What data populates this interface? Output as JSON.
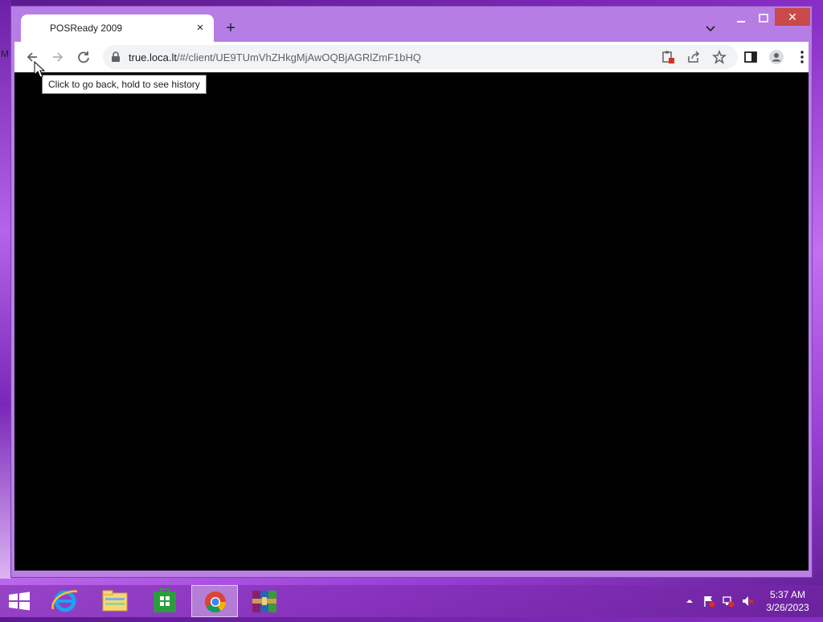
{
  "desktop": {
    "edge_letter": "M"
  },
  "browser": {
    "tab": {
      "title": "POSReady 2009",
      "close_glyph": "×"
    },
    "new_tab_glyph": "+",
    "window_controls": {
      "close_glyph": "✕"
    },
    "address_bar": {
      "host": "true.loca.lt",
      "path": "/#/client/UE9TUmVhZHkgMjAwOQBjAGRlZmF1bHQ"
    },
    "tooltip": "Click to go back, hold to see history",
    "icons": [
      "back-arrow-icon",
      "forward-arrow-icon",
      "reload-icon",
      "lock-icon",
      "clipboard-blocked-icon",
      "share-icon",
      "bookmark-star-icon",
      "side-panel-icon",
      "profile-icon",
      "kebab-menu-icon",
      "tab-search-icon"
    ]
  },
  "taskbar": {
    "apps": [
      "start-button",
      "internet-explorer",
      "file-explorer",
      "store",
      "chrome",
      "winrar"
    ],
    "active_app": "chrome",
    "clock": {
      "time": "5:37 AM",
      "date": "3/26/2023"
    }
  },
  "colors": {
    "titlebar": "#b67de4",
    "close_button": "#c94a4a",
    "viewport": "#000000"
  }
}
